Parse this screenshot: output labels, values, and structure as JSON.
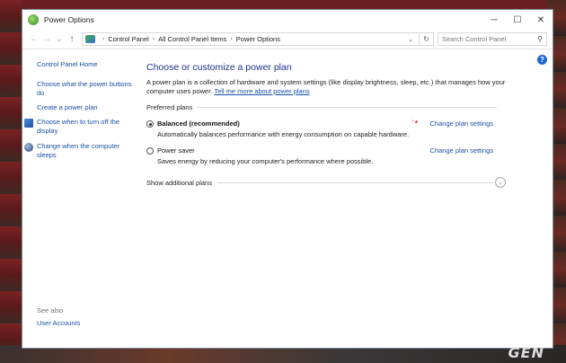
{
  "window": {
    "title": "Power Options",
    "controls": {
      "minimize": "─",
      "maximize": "☐",
      "close": "✕"
    }
  },
  "address": {
    "breadcrumbs": [
      "Control Panel",
      "All Control Panel Items",
      "Power Options"
    ],
    "search_placeholder": "Search Control Panel"
  },
  "sidebar": {
    "home": "Control Panel Home",
    "links": [
      "Choose what the power buttons do",
      "Create a power plan"
    ],
    "icon_links": [
      {
        "label": "Choose when to turn off the display",
        "icon": "monitor-icon"
      },
      {
        "label": "Change when the computer sleeps",
        "icon": "moon-icon"
      }
    ],
    "see_also": "See also",
    "user_accounts": "User Accounts"
  },
  "main": {
    "title": "Choose or customize a power plan",
    "description": "A power plan is a collection of hardware and system settings (like display brightness, sleep, etc.) that manages how your computer uses power.",
    "learn_more": "Tell me more about power plans",
    "preferred_label": "Preferred plans",
    "plans": [
      {
        "name": "Balanced (recommended)",
        "desc": "Automatically balances performance with energy consumption on capable hardware.",
        "link": "Change plan settings",
        "selected": true
      },
      {
        "name": "Power saver",
        "desc": "Saves energy by reducing your computer's performance where possible.",
        "link": "Change plan settings",
        "selected": false
      }
    ],
    "show_additional": "Show additional plans"
  },
  "watermark": "GEN",
  "colors": {
    "link": "#1a4fa3",
    "title": "#1e3287",
    "help": "#1f66d1",
    "arrow": "#e02020"
  }
}
